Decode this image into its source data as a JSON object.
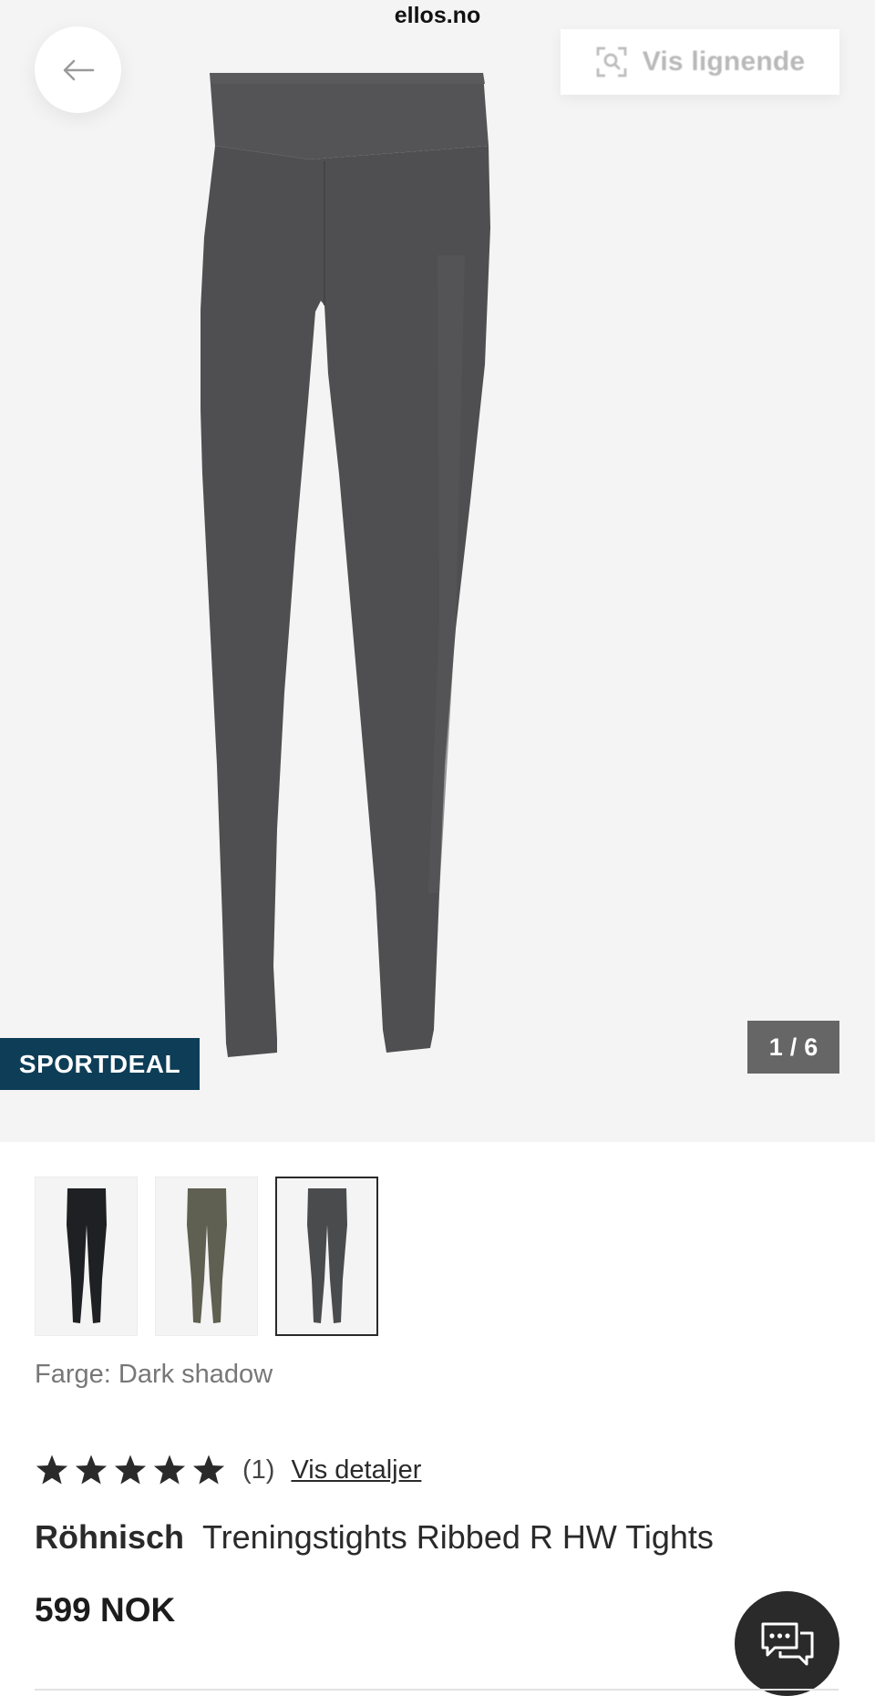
{
  "browser": {
    "url": "ellos.no"
  },
  "header": {
    "similar_label": "Vis lignende"
  },
  "gallery": {
    "badge": "SPORTDEAL",
    "current": "1",
    "separator": "/",
    "total": "6"
  },
  "variants": [
    {
      "name": "black",
      "color": "#1f2023",
      "selected": false
    },
    {
      "name": "olive",
      "color": "#5f5f52",
      "selected": false
    },
    {
      "name": "dark-shadow",
      "color": "#4a4b4d",
      "selected": true
    }
  ],
  "color_info": {
    "label": "Farge:",
    "value": "Dark shadow"
  },
  "rating": {
    "stars": 5,
    "max": 5,
    "count": "(1)",
    "link": "Vis detaljer"
  },
  "product": {
    "brand": "Röhnisch",
    "name": "Treningstights Ribbed R HW Tights",
    "price": "599 NOK"
  },
  "colors": {
    "badge_bg": "#0d3d57",
    "counter_bg": "#666666",
    "chat_bg": "#2a2a2a",
    "image_bg": "#f4f4f4"
  }
}
